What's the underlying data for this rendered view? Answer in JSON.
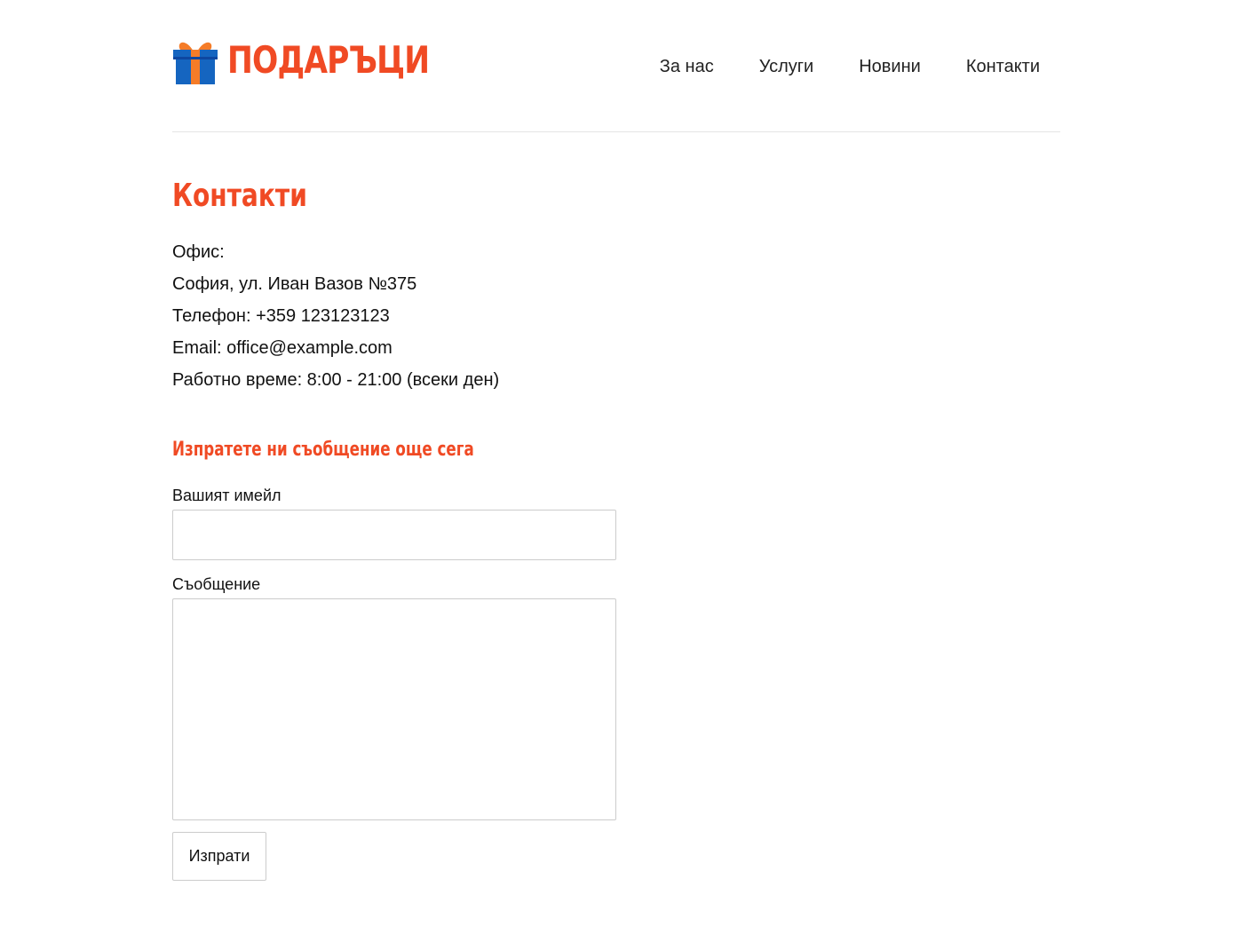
{
  "header": {
    "logo": {
      "text": "ПОДАРЪЦИ",
      "icon": "gift-icon"
    },
    "nav": [
      {
        "label": "За нас"
      },
      {
        "label": "Услуги"
      },
      {
        "label": "Новини"
      },
      {
        "label": "Контакти"
      }
    ]
  },
  "main": {
    "title": "Контакти",
    "contact_lines": [
      "Офис:",
      "София, ул. Иван Вазов №375",
      "Телефон: +359 123123123",
      "Email: office@example.com",
      "Работно време: 8:00 - 21:00 (всеки ден)"
    ],
    "form": {
      "title": "Изпратете ни съобщение още сега",
      "email_label": "Вашият имейл",
      "email_value": "",
      "message_label": "Съобщение",
      "message_value": "",
      "submit_label": "Изпрати"
    }
  },
  "colors": {
    "accent": "#f04a24",
    "gift_box": "#1565c0",
    "gift_ribbon": "#f57c28",
    "divider": "#e5e5e5",
    "field_border": "#cccccc"
  }
}
